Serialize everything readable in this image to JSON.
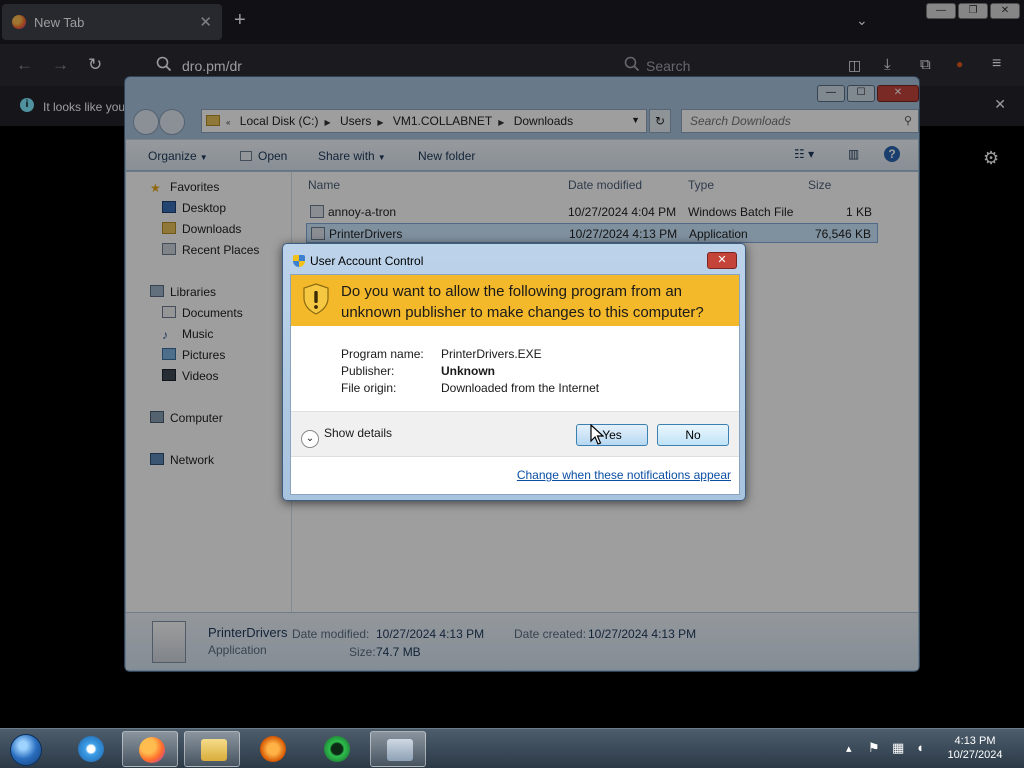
{
  "firefox": {
    "tab_title": "New Tab",
    "url_text": "dro.pm/dr",
    "search_placeholder": "Search",
    "notification_text": "It looks like you"
  },
  "explorer": {
    "breadcrumbs": [
      "Local Disk (C:)",
      "Users",
      "VM1.COLLABNET",
      "Downloads"
    ],
    "search_placeholder": "Search Downloads",
    "toolbar": {
      "organize": "Organize",
      "open": "Open",
      "share_with": "Share with",
      "new_folder": "New folder"
    },
    "nav": {
      "favorites": "Favorites",
      "desktop": "Desktop",
      "downloads": "Downloads",
      "recent_places": "Recent Places",
      "libraries": "Libraries",
      "documents": "Documents",
      "music": "Music",
      "pictures": "Pictures",
      "videos": "Videos",
      "computer": "Computer",
      "network": "Network"
    },
    "columns": {
      "name": "Name",
      "date_modified": "Date modified",
      "type": "Type",
      "size": "Size"
    },
    "files": [
      {
        "name": "annoy-a-tron",
        "date": "10/27/2024 4:04 PM",
        "type": "Windows Batch File",
        "size": "1 KB"
      },
      {
        "name": "PrinterDrivers",
        "date": "10/27/2024 4:13 PM",
        "type": "Application",
        "size": "76,546 KB"
      }
    ],
    "details": {
      "name": "PrinterDrivers",
      "type": "Application",
      "date_modified_label": "Date modified:",
      "date_modified": "10/27/2024 4:13 PM",
      "date_created_label": "Date created:",
      "date_created": "10/27/2024 4:13 PM",
      "size_label": "Size:",
      "size": "74.7 MB"
    }
  },
  "uac": {
    "title": "User Account Control",
    "question": "Do you want to allow the following program from an unknown publisher to make changes to this computer?",
    "program_name_label": "Program name:",
    "program_name": "PrinterDrivers.EXE",
    "publisher_label": "Publisher:",
    "publisher": "Unknown",
    "file_origin_label": "File origin:",
    "file_origin": "Downloaded from the Internet",
    "show_details": "Show details",
    "yes": "Yes",
    "no": "No",
    "change_link": "Change when these notifications appear",
    "banner_color": "#f4b92a"
  },
  "taskbar": {
    "time": "4:13 PM",
    "date": "10/27/2024"
  }
}
